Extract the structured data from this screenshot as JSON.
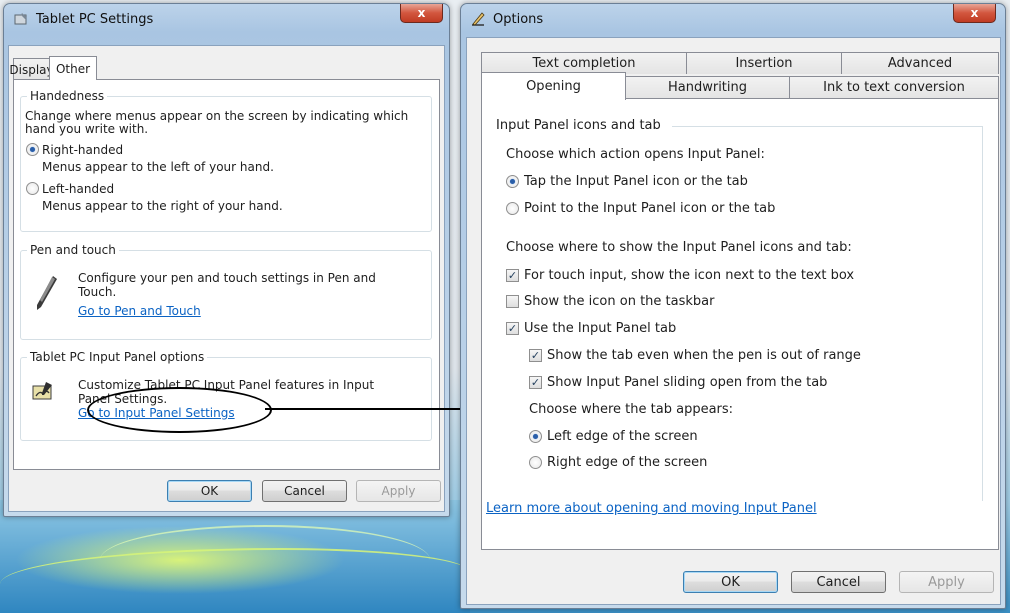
{
  "left_window": {
    "title": "Tablet PC Settings",
    "close_label": "x",
    "tabs": [
      {
        "label": "Display",
        "selected": false
      },
      {
        "label": "Other",
        "selected": true
      }
    ],
    "handedness": {
      "title": "Handedness",
      "description_line1": "Change where menus appear on the screen by indicating which",
      "description_line2": "hand you write with.",
      "right_label": "Right-handed",
      "right_desc": "Menus appear to the left of your hand.",
      "right_selected": true,
      "left_label": "Left-handed",
      "left_desc": "Menus appear to the right of your hand.",
      "left_selected": false
    },
    "pen_touch": {
      "title": "Pen and touch",
      "desc_line1": "Configure your pen and touch settings in Pen and",
      "desc_line2": "Touch.",
      "link": "Go to Pen and Touch",
      "icon": "pen-icon"
    },
    "input_panel": {
      "title": "Tablet PC Input Panel options",
      "desc_line1": "Customize Tablet PC Input Panel features in Input",
      "desc_line2": "Panel Settings.",
      "link": "Go to Input Panel Settings",
      "icon": "input-panel-icon"
    },
    "buttons": {
      "ok": "OK",
      "cancel": "Cancel",
      "apply": "Apply"
    }
  },
  "right_window": {
    "title": "Options",
    "close_label": "x",
    "tabs_row1": [
      "Text completion",
      "Insertion",
      "Advanced"
    ],
    "tabs_row2": [
      "Opening",
      "Handwriting",
      "Ink to text conversion"
    ],
    "selected_tab": "Opening",
    "group_title": "Input Panel icons and tab",
    "action_heading": "Choose which action opens Input Panel:",
    "action_options": [
      {
        "label": "Tap the Input Panel icon or the tab",
        "selected": true
      },
      {
        "label": "Point to the Input Panel icon or the tab",
        "selected": false
      }
    ],
    "where_heading": "Choose where to show the Input Panel icons and tab:",
    "checkboxes": [
      {
        "label": "For touch input, show the icon next to the text box",
        "checked": true
      },
      {
        "label": "Show the icon on the taskbar",
        "checked": false
      },
      {
        "label": "Use the Input Panel tab",
        "checked": true
      },
      {
        "label": "Show the tab even when the pen is out of range",
        "checked": true
      },
      {
        "label": "Show Input Panel sliding open from the tab",
        "checked": true
      }
    ],
    "tab_heading": "Choose where the tab appears:",
    "edge_options": [
      {
        "label": "Left edge of the screen",
        "selected": true
      },
      {
        "label": "Right edge of the screen",
        "selected": false
      }
    ],
    "learn_more": "Learn more about opening and moving Input Panel",
    "buttons": {
      "ok": "OK",
      "cancel": "Cancel",
      "apply": "Apply"
    }
  },
  "check_mark": "✓",
  "colors": {
    "link": "#0b63c4",
    "close": "#c03b24",
    "radio_dot": "#2a5ea8"
  }
}
